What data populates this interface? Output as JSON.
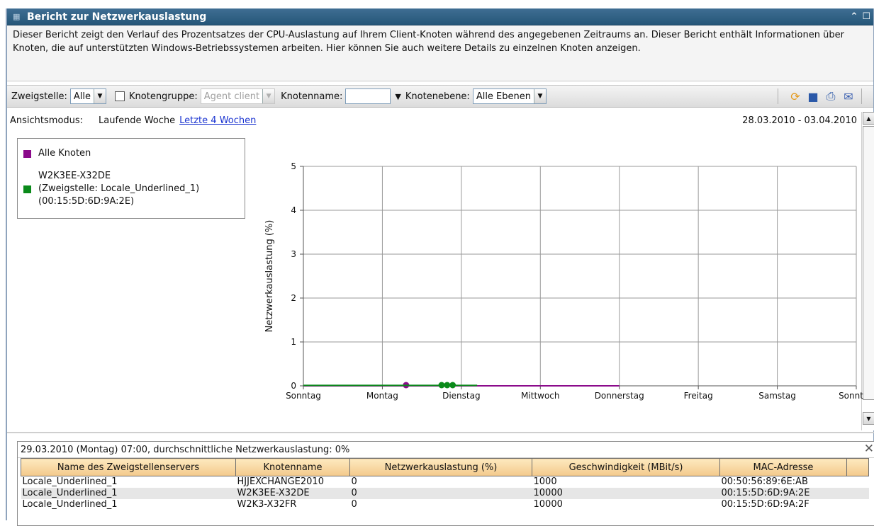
{
  "window": {
    "title": "Bericht zur Netzwerkauslastung",
    "collapse_icon": "double-chevron-up",
    "maximize_icon": "square"
  },
  "description": "Dieser Bericht zeigt den Verlauf des Prozentsatzes der CPU-Auslastung auf Ihrem Client-Knoten während des angegebenen Zeitraums an. Dieser Bericht enthält Informationen über Knoten, die auf unterstützten Windows-Betriebssystemen arbeiten. Hier können Sie auch weitere Details zu einzelnen Knoten anzeigen.",
  "toolbar": {
    "branch_label": "Zweigstelle:",
    "branch_value": "Alle",
    "nodegroup_label": "Knotengruppe:",
    "nodegroup_value": "Agent client",
    "nodename_label": "Knotenname:",
    "nodename_value": "",
    "nodelevel_label": "Knotenebene:",
    "nodelevel_value": "Alle Ebenen",
    "tools": [
      "refresh-icon",
      "save-icon",
      "print-icon",
      "email-icon"
    ]
  },
  "mode": {
    "label": "Ansichtsmodus:",
    "current": "Laufende Woche",
    "link": "Letzte 4 Wochen",
    "range": "28.03.2010 - 03.04.2010"
  },
  "legend": {
    "items": [
      {
        "label": "Alle Knoten",
        "color": "#8b0a8b"
      },
      {
        "label_line1": "W2K3EE-X32DE",
        "label_line2": "(Zweigstelle: Locale_Underlined_1)",
        "label_line3": "(00:15:5D:6D:9A:2E)",
        "color": "#0a8a1a"
      }
    ]
  },
  "chart_data": {
    "type": "line",
    "ylabel": "Netzwerkauslastung (%)",
    "categories": [
      "Sonntag",
      "Montag",
      "Dienstag",
      "Mittwoch",
      "Donnerstag",
      "Freitag",
      "Samstag",
      "Sonntag"
    ],
    "ylim": [
      0,
      5
    ],
    "yticks": [
      0,
      1,
      2,
      3,
      4,
      5
    ],
    "grid": true,
    "series": [
      {
        "name": "Alle Knoten",
        "color": "#8b0a8b",
        "x_days": [
          0,
          4
        ],
        "y": [
          0,
          0
        ],
        "markers": [
          1.3
        ]
      },
      {
        "name": "W2K3EE-X32DE",
        "color": "#0a8a1a",
        "x_days": [
          0,
          2.2
        ],
        "y": [
          0,
          0
        ],
        "markers": [
          1.75,
          1.82,
          1.89
        ]
      }
    ]
  },
  "detail": {
    "header": "29.03.2010 (Montag) 07:00, durchschnittliche Netzwerkauslastung: 0%",
    "columns": [
      "Name des Zweigstellenservers",
      "Knotenname",
      "Netzwerkauslastung (%)",
      "Geschwindigkeit (MBit/s)",
      "MAC-Adresse"
    ],
    "rows": [
      [
        "Locale_Underlined_1",
        "HJJEXCHANGE2010",
        "0",
        "1000",
        "00:50:56:89:6E:AB"
      ],
      [
        "Locale_Underlined_1",
        "W2K3EE-X32DE",
        "0",
        "10000",
        "00:15:5D:6D:9A:2E"
      ],
      [
        "Locale_Underlined_1",
        "W2K3-X32FR",
        "0",
        "10000",
        "00:15:5D:6D:9A:2F"
      ]
    ]
  }
}
